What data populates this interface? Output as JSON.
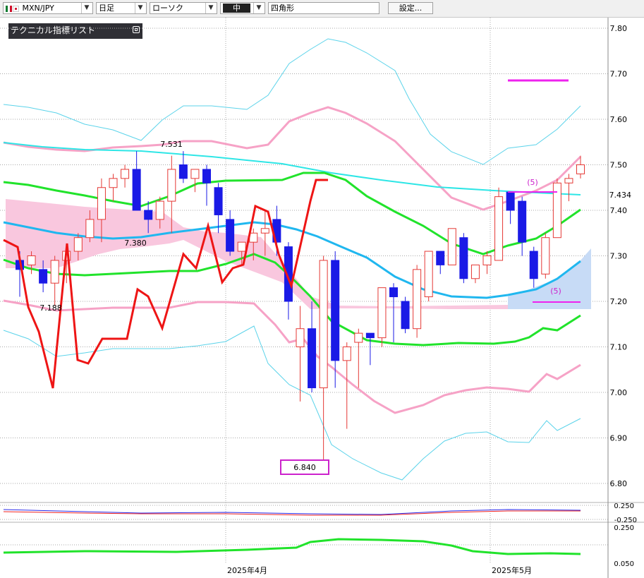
{
  "toolbar": {
    "symbol": "MXN/JPY",
    "period": "日足",
    "chart_style": "ローソク",
    "line_width": "中",
    "drawing_tool": "四角形",
    "settings_label": "設定..."
  },
  "legend": {
    "title": "テクニカル指標リスト"
  },
  "colors": {
    "bull": "#e53935",
    "bear": "#1a1ae6",
    "bb": "#5bd3ea",
    "bb2": "#f6a2c6",
    "cloud_bull": "#f9c7de",
    "cloud_bear": "#c7dbf6"
  },
  "chart_data": {
    "type": "candlestick",
    "symbol": "MXN/JPY",
    "x_labels": [
      "2025年4月",
      "2025年5月"
    ],
    "y_ticks": [
      "7.80",
      "7.70",
      "7.60",
      "7.50",
      "7.40",
      "7.30",
      "7.20",
      "7.10",
      "7.00",
      "6.90",
      "6.80"
    ],
    "ylim": [
      6.78,
      7.82
    ],
    "current_price_label": "7.434",
    "annotations": [
      {
        "text": "7.531",
        "value": 7.531
      },
      {
        "text": "7.380",
        "value": 7.38
      },
      {
        "text": "7.188",
        "value": 7.188
      },
      {
        "text": "6.840",
        "value": 6.84
      },
      {
        "text": "(5)",
        "value": 7.44
      },
      {
        "text": "(5)",
        "value": 7.21
      }
    ],
    "sub1_ticks": [
      "0.250",
      "-0.250"
    ],
    "sub2_ticks": [
      "0.250",
      "0.050"
    ],
    "candles": [
      [
        7.29,
        7.31,
        7.21,
        7.27
      ],
      [
        7.28,
        7.31,
        7.26,
        7.3
      ],
      [
        7.27,
        7.29,
        7.22,
        7.24
      ],
      [
        7.24,
        7.3,
        7.19,
        7.29
      ],
      [
        7.29,
        7.32,
        7.24,
        7.31
      ],
      [
        7.31,
        7.35,
        7.29,
        7.34
      ],
      [
        7.34,
        7.4,
        7.33,
        7.38
      ],
      [
        7.38,
        7.47,
        7.33,
        7.45
      ],
      [
        7.45,
        7.48,
        7.42,
        7.47
      ],
      [
        7.47,
        7.5,
        7.45,
        7.49
      ],
      [
        7.49,
        7.53,
        7.41,
        7.4
      ],
      [
        7.4,
        7.42,
        7.35,
        7.38
      ],
      [
        7.38,
        7.43,
        7.36,
        7.42
      ],
      [
        7.42,
        7.52,
        7.35,
        7.49
      ],
      [
        7.5,
        7.53,
        7.46,
        7.47
      ],
      [
        7.47,
        7.49,
        7.44,
        7.49
      ],
      [
        7.49,
        7.5,
        7.41,
        7.46
      ],
      [
        7.45,
        7.46,
        7.35,
        7.39
      ],
      [
        7.38,
        7.4,
        7.3,
        7.31
      ],
      [
        7.31,
        7.33,
        7.28,
        7.33
      ],
      [
        7.33,
        7.36,
        7.29,
        7.35
      ],
      [
        7.35,
        7.4,
        7.3,
        7.36
      ],
      [
        7.38,
        7.41,
        7.3,
        7.33
      ],
      [
        7.32,
        7.33,
        7.16,
        7.2
      ],
      [
        7.1,
        7.19,
        6.98,
        7.14
      ],
      [
        7.14,
        7.2,
        7.0,
        7.01
      ],
      [
        7.01,
        7.3,
        6.84,
        7.29
      ],
      [
        7.29,
        7.31,
        7.01,
        7.07
      ],
      [
        7.07,
        7.11,
        6.92,
        7.1
      ],
      [
        7.11,
        7.14,
        7.01,
        7.13
      ],
      [
        7.13,
        7.13,
        7.06,
        7.12
      ],
      [
        7.12,
        7.22,
        7.1,
        7.23
      ],
      [
        7.23,
        7.24,
        7.11,
        7.21
      ],
      [
        7.2,
        7.21,
        7.13,
        7.14
      ],
      [
        7.14,
        7.28,
        7.12,
        7.27
      ],
      [
        7.21,
        7.31,
        7.2,
        7.31
      ],
      [
        7.31,
        7.31,
        7.26,
        7.28
      ],
      [
        7.28,
        7.36,
        7.28,
        7.36
      ],
      [
        7.34,
        7.35,
        7.24,
        7.25
      ],
      [
        7.25,
        7.28,
        7.24,
        7.28
      ],
      [
        7.28,
        7.31,
        7.26,
        7.3
      ],
      [
        7.29,
        7.45,
        7.29,
        7.43
      ],
      [
        7.44,
        7.42,
        7.37,
        7.4
      ],
      [
        7.42,
        7.43,
        7.3,
        7.33
      ],
      [
        7.31,
        7.32,
        7.23,
        7.25
      ],
      [
        7.26,
        7.35,
        7.25,
        7.34
      ],
      [
        7.34,
        7.47,
        7.35,
        7.46
      ],
      [
        7.46,
        7.48,
        7.42,
        7.47
      ],
      [
        7.48,
        7.52,
        7.47,
        7.5
      ]
    ]
  }
}
